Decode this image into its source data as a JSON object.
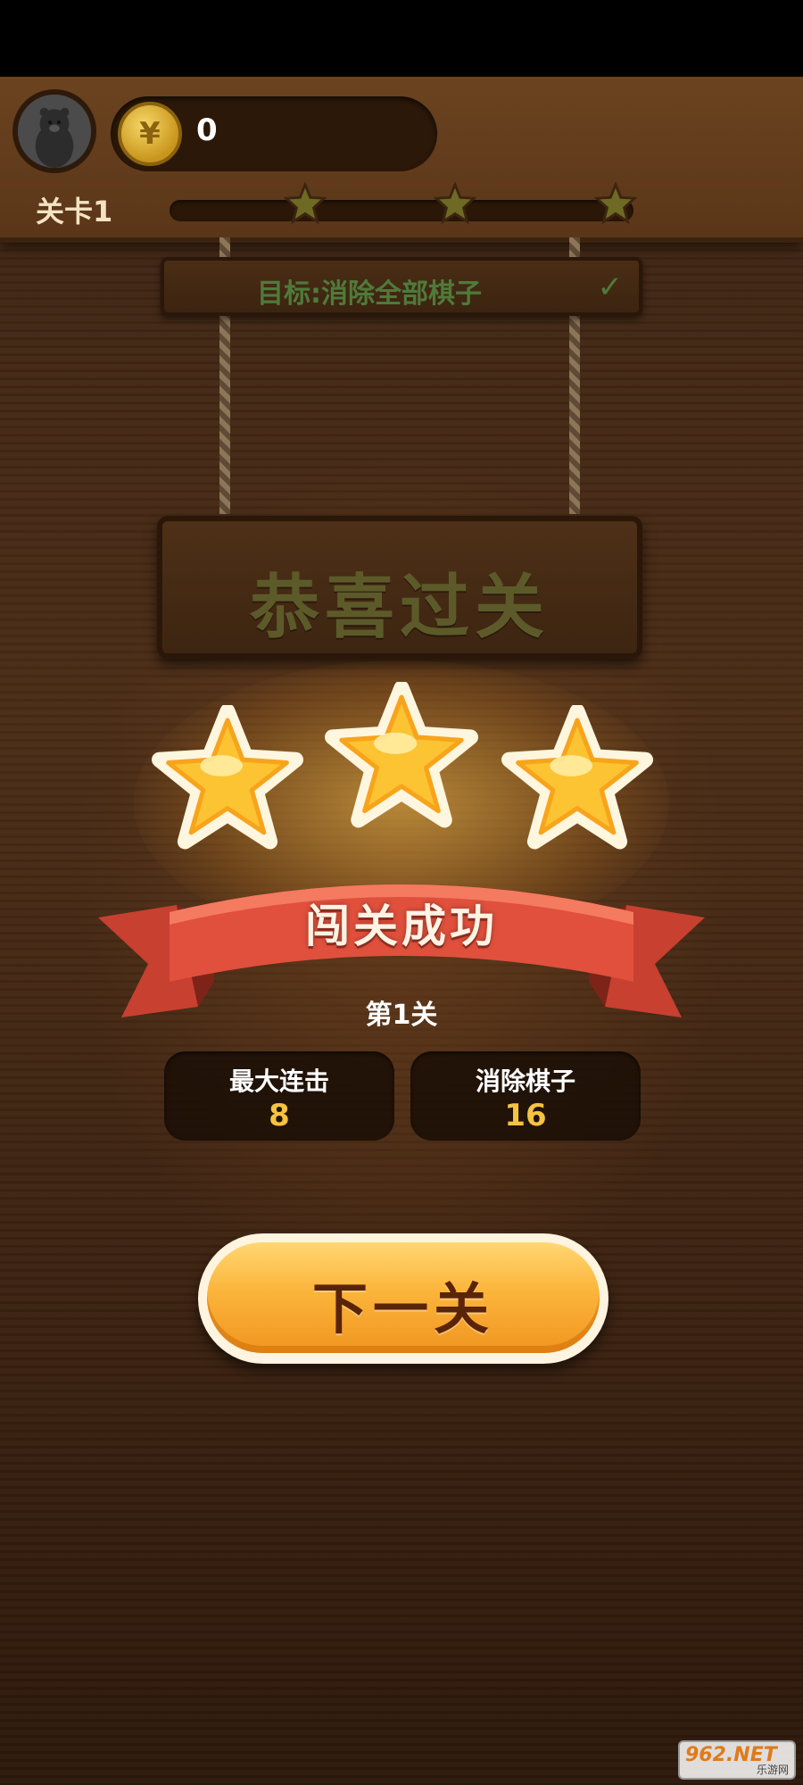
{
  "hud": {
    "coins": "0",
    "coin_symbol": "¥",
    "level_label": "关卡1",
    "progress": 0.0
  },
  "goal": {
    "text": "目标:消除全部棋子",
    "check": "✓"
  },
  "result": {
    "title": "恭喜过关",
    "stars_earned": 3,
    "banner": "闯关成功",
    "level": "第1关"
  },
  "stats": {
    "max_combo_label": "最大连击",
    "max_combo_value": "8",
    "cleared_label": "消除棋子",
    "cleared_value": "16"
  },
  "actions": {
    "next_label": "下一关"
  },
  "watermark": {
    "main": "962.NET",
    "sub": "乐游网"
  },
  "colors": {
    "star_gold": "#fcd34d",
    "ribbon_red": "#e0503c",
    "button_orange": "#fbb43a"
  }
}
